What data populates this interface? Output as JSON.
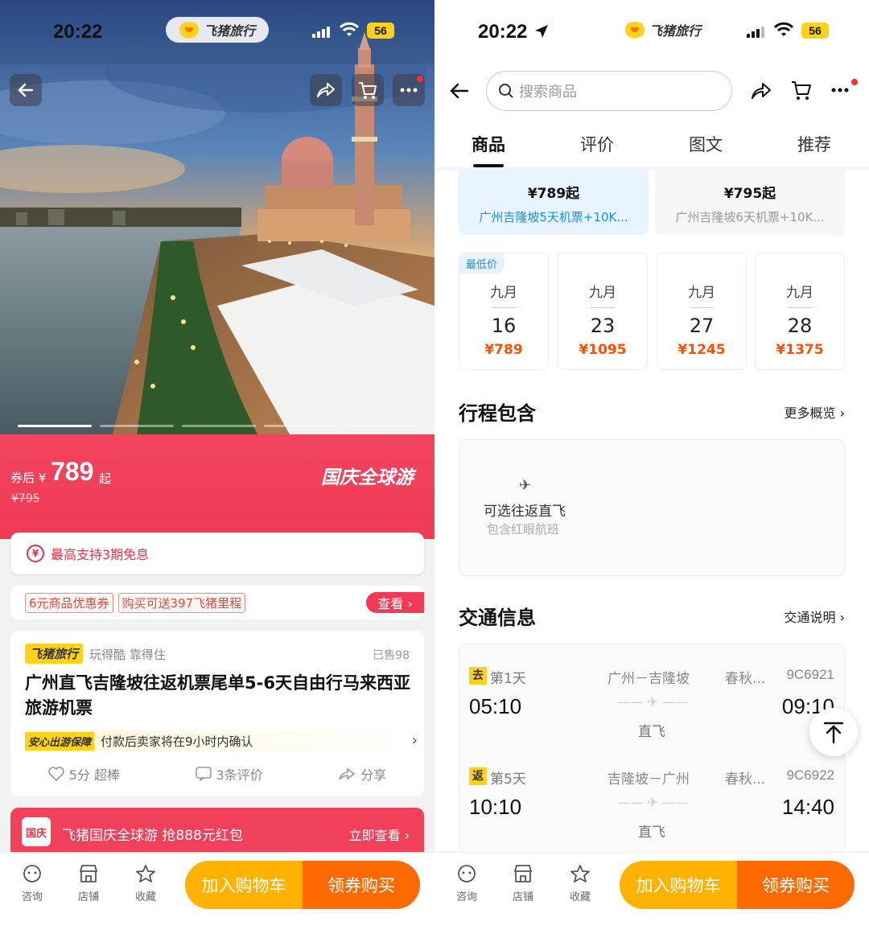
{
  "left": {
    "status": {
      "time": "20:22",
      "battery": "56"
    },
    "brand": {
      "name": "飞猪旅行"
    },
    "price": {
      "prefix": "券后 ¥",
      "amount": "789",
      "suffix": "起",
      "original": "¥795",
      "promo": "国庆全球游"
    },
    "installment": {
      "text": "最高支持3期免息",
      "icon": "¥"
    },
    "coupons": {
      "tag1": "6元商品优惠券",
      "tag2": "购买可送397飞猪里程",
      "look": "查看 ›"
    },
    "product": {
      "brand_tag": "飞猪旅行",
      "slogan": "玩得酷 靠得住",
      "sold": "已售98",
      "title": "广州直飞吉隆坡往返机票尾单5-6天自由行马来西亚旅游机票",
      "safe_tag": "安心出游保障",
      "safe_text": "付款后卖家将在9小时内确认",
      "score": "5分 超棒",
      "reviews": "3条评价",
      "share": "分享"
    },
    "red_card": {
      "badge": "国庆",
      "text": "飞猪国庆全球游 抢888元红包",
      "go": "立即查看 ›"
    },
    "bottom": {
      "consult": "咨询",
      "shop": "店铺",
      "fav": "收藏",
      "cart": "加入购物车",
      "buy": "领券购买"
    }
  },
  "right": {
    "status": {
      "time": "20:22",
      "battery": "56"
    },
    "brand": {
      "name": "飞猪旅行"
    },
    "search": {
      "placeholder": "搜索商品"
    },
    "tabs": [
      "商品",
      "评价",
      "图文",
      "推荐"
    ],
    "packages": [
      {
        "price": "¥789起",
        "desc": "广州吉隆坡5天机票+10K..."
      },
      {
        "price": "¥795起",
        "desc": "广州吉隆坡6天机票+10K..."
      }
    ],
    "low_tag": "最低价",
    "dates": [
      {
        "month": "九月",
        "day": "16",
        "price": "¥789"
      },
      {
        "month": "九月",
        "day": "23",
        "price": "¥1095"
      },
      {
        "month": "九月",
        "day": "27",
        "price": "¥1245"
      },
      {
        "month": "九月",
        "day": "28",
        "price": "¥1375"
      }
    ],
    "itinerary": {
      "title": "行程包含",
      "more": "更多概览 ›",
      "item": "可选往返直飞",
      "sub": "包含红眼航班"
    },
    "traffic": {
      "title": "交通信息",
      "more": "交通说明 ›",
      "legs": [
        {
          "tag": "去",
          "day": "第1天",
          "dep": "05:10",
          "route": "广州－吉隆坡",
          "type": "直飞",
          "airline": "春秋...",
          "flight": "9C6921",
          "arr": "09:10"
        },
        {
          "tag": "返",
          "day": "第5天",
          "dep": "10:10",
          "route": "吉隆坡－广州",
          "type": "直飞",
          "airline": "春秋...",
          "flight": "9C6922",
          "arr": "14:40"
        }
      ]
    },
    "bottom": {
      "consult": "咨询",
      "shop": "店铺",
      "fav": "收藏",
      "cart": "加入购物车",
      "buy": "领券购买"
    }
  },
  "colors": {
    "brand_yellow": "#ffd21a",
    "promo_red": "#f03a56",
    "cart_orange": "#ffb300",
    "buy_orange": "#ff6a00",
    "price_orange": "#ff5000",
    "link_blue": "#1890e8"
  }
}
